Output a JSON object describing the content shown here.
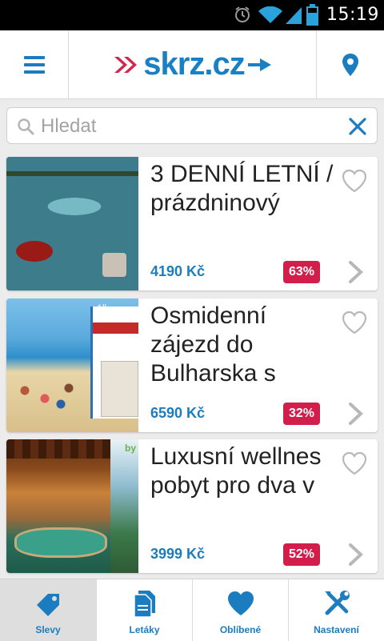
{
  "status_bar": {
    "time": "15:19"
  },
  "header": {
    "logo_text": "skrz.cz",
    "menu_icon": "hamburger-menu-icon",
    "location_icon": "location-pin-icon"
  },
  "search": {
    "placeholder": "Hledat",
    "value": ""
  },
  "colors": {
    "accent": "#1c7cc0",
    "badge": "#d21e4b",
    "logo_arrow": "#d6244d"
  },
  "deals": [
    {
      "title": "3 DENNÍ LETNÍ / prázdninový",
      "price": "4190 Kč",
      "discount": "63%"
    },
    {
      "title": "Osmidenní zájezd do Bulharska s",
      "price": "6590 Kč",
      "discount": "32%"
    },
    {
      "title": "Luxusní wellnes pobyt pro dva v",
      "price": "3999 Kč",
      "discount": "52%"
    }
  ],
  "image_text": {
    "beach_tag": "All inclusive",
    "wellness_tag": "by"
  },
  "bottom_nav": [
    {
      "label": "Slevy",
      "icon": "tag-icon",
      "active": true
    },
    {
      "label": "Letáky",
      "icon": "leaflets-icon",
      "active": false
    },
    {
      "label": "Oblíbené",
      "icon": "heart-icon",
      "active": false
    },
    {
      "label": "Nastavení",
      "icon": "settings-tools-icon",
      "active": false
    }
  ]
}
